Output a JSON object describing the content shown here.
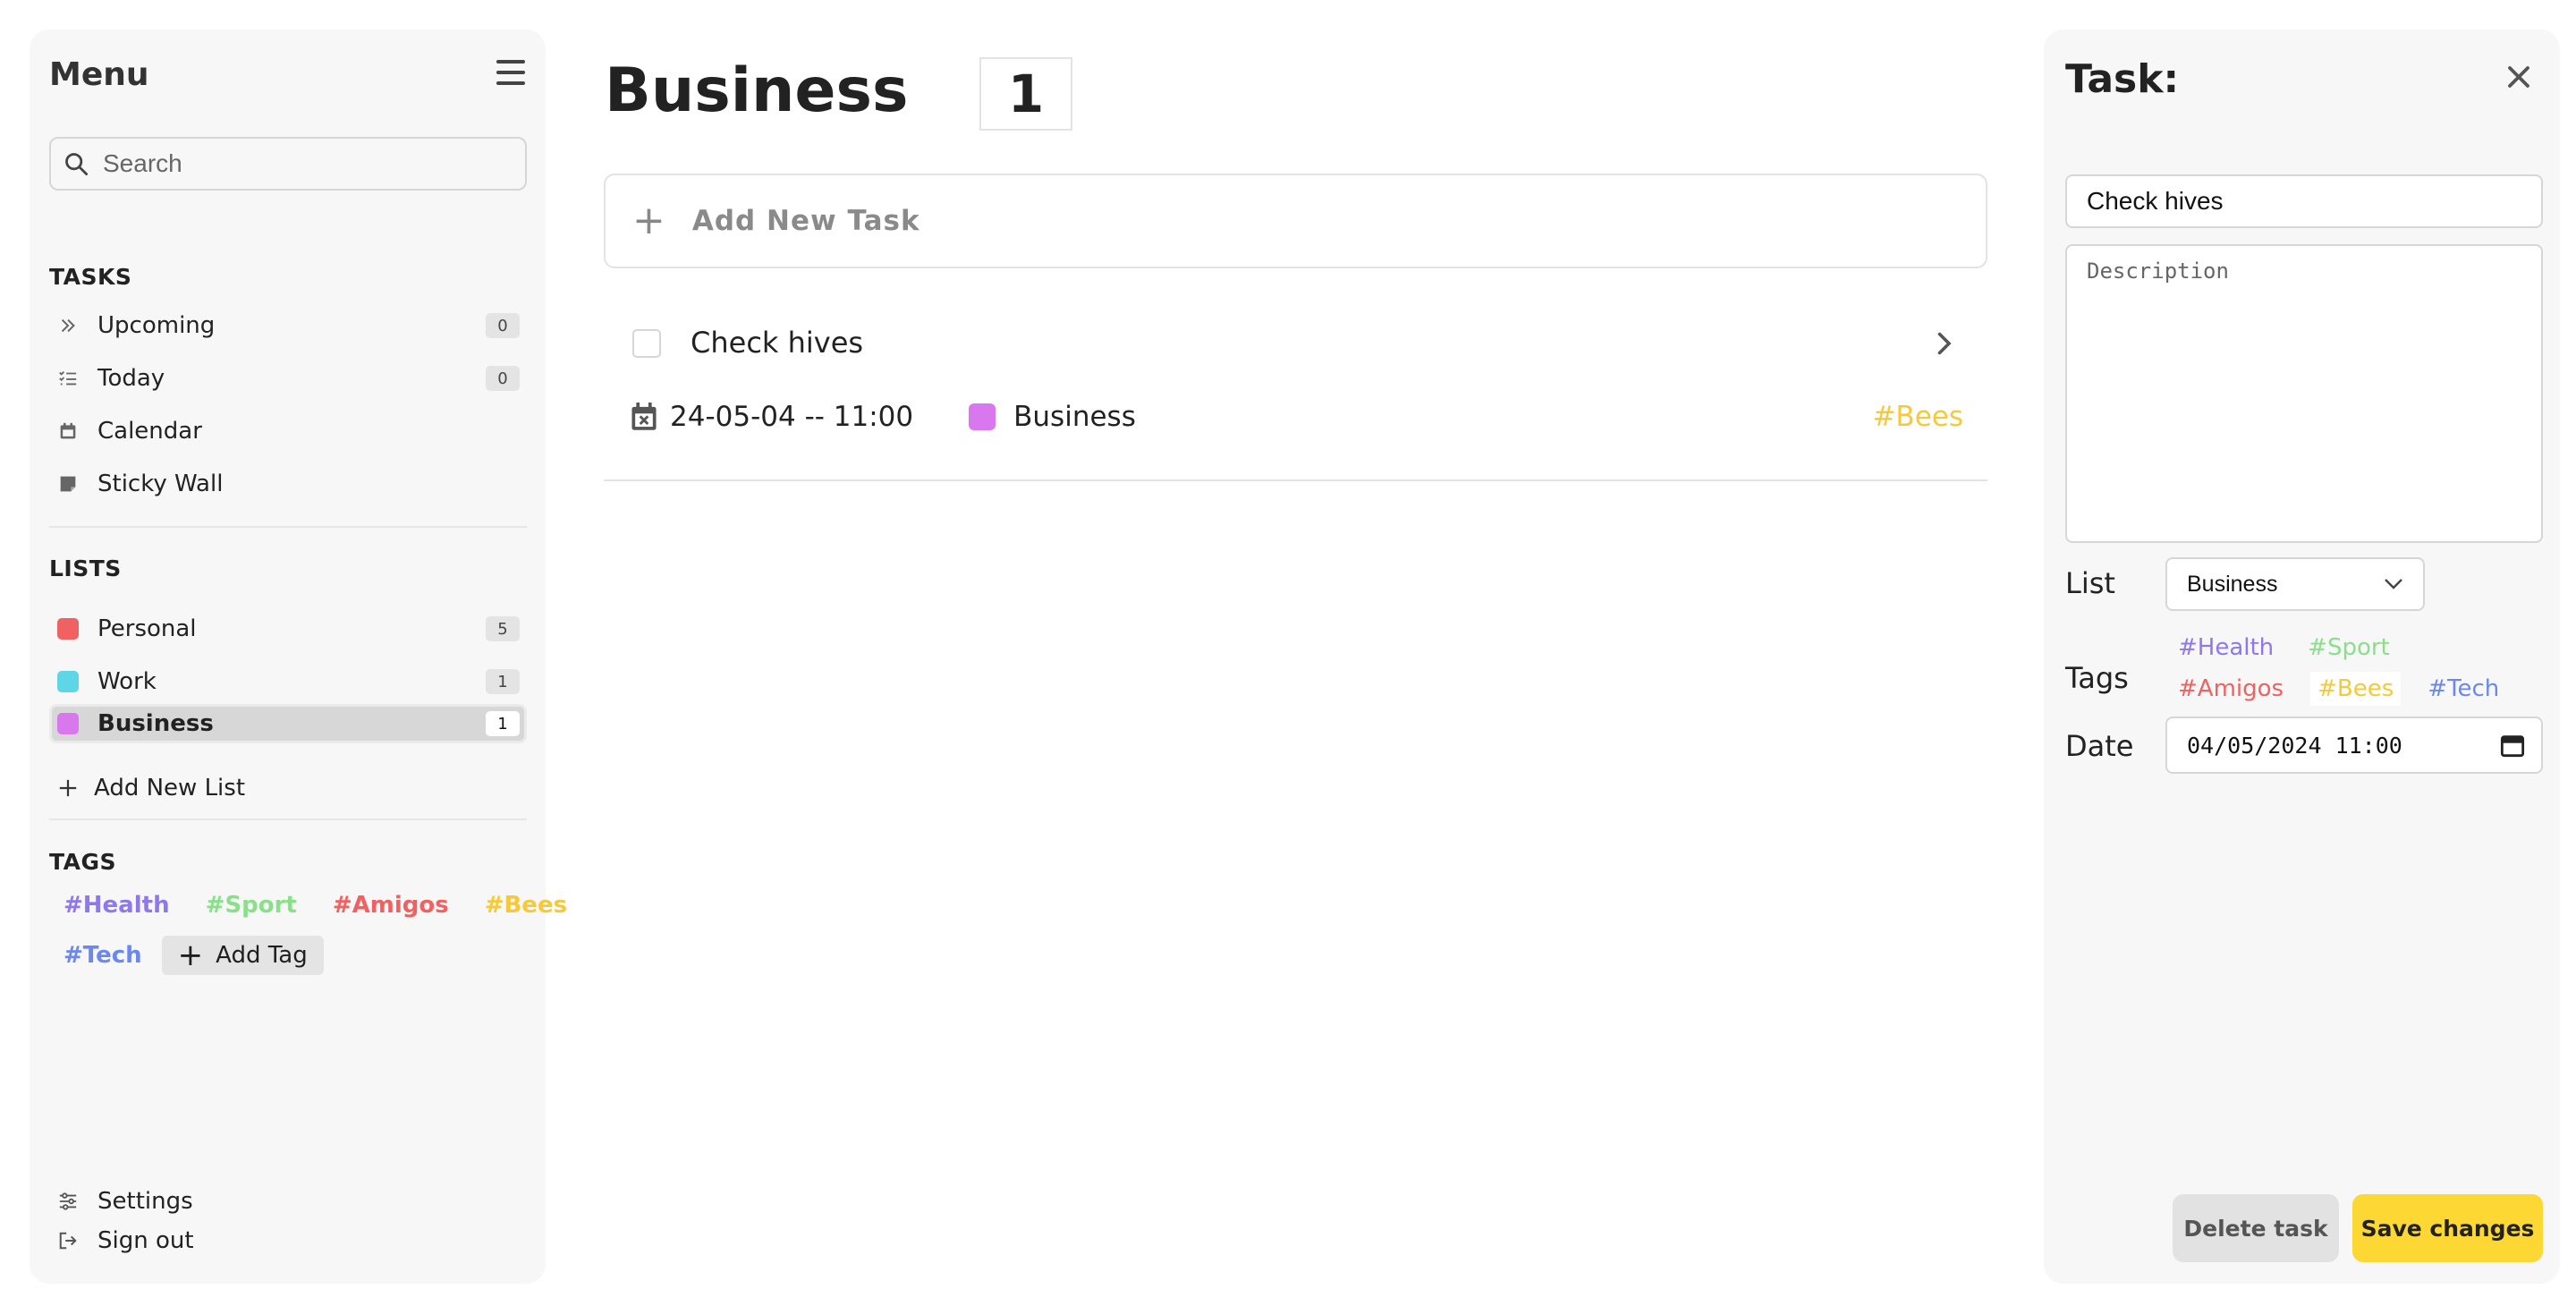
{
  "sidebar": {
    "title": "Menu",
    "search": {
      "placeholder": "Search",
      "value": ""
    },
    "tasks_label": "TASKS",
    "tasks": [
      {
        "label": "Upcoming",
        "count": "0",
        "icon": "double-chevron-right-icon"
      },
      {
        "label": "Today",
        "count": "0",
        "icon": "list-check-icon"
      },
      {
        "label": "Calendar",
        "count": "",
        "icon": "calendar-icon"
      },
      {
        "label": "Sticky Wall",
        "count": "",
        "icon": "sticky-note-icon"
      }
    ],
    "lists_label": "LISTS",
    "lists": [
      {
        "label": "Personal",
        "count": "5",
        "color": "#f06262"
      },
      {
        "label": "Work",
        "count": "1",
        "color": "#5ed6e8"
      },
      {
        "label": "Business",
        "count": "1",
        "color": "#d977ee",
        "active": true
      }
    ],
    "add_list_label": "Add New List",
    "tags_label": "TAGS",
    "tags": [
      {
        "label": "#Health",
        "color": "#8f78ee"
      },
      {
        "label": "#Sport",
        "color": "#8bdf8b"
      },
      {
        "label": "#Amigos",
        "color": "#f06262"
      },
      {
        "label": "#Bees",
        "color": "#f6c93a"
      },
      {
        "label": "#Tech",
        "color": "#6b88ee"
      }
    ],
    "add_tag_label": "Add Tag",
    "settings_label": "Settings",
    "signout_label": "Sign out"
  },
  "main": {
    "title": "Business",
    "count": "1",
    "add_task_label": "Add New Task",
    "task": {
      "name": "Check hives",
      "date": "24-05-04 -- 11:00",
      "list": "Business",
      "list_color": "#d977ee",
      "tag": "#Bees"
    }
  },
  "panel": {
    "title": "Task:",
    "name_value": "Check hives",
    "description_placeholder": "Description",
    "list_label": "List",
    "list_value": "Business",
    "tags_label": "Tags",
    "tags": [
      {
        "label": "#Health",
        "color": "#8f78ee"
      },
      {
        "label": "#Sport",
        "color": "#8bdf8b"
      },
      {
        "label": "#Amigos",
        "color": "#f06262"
      },
      {
        "label": "#Bees",
        "color": "#f6c93a"
      },
      {
        "label": "#Tech",
        "color": "#6b88ee"
      }
    ],
    "date_label": "Date",
    "date_value": "04/05/2024 11:00",
    "delete_label": "Delete task",
    "save_label": "Save changes"
  },
  "colors": {
    "accent": "#fdd835",
    "sidebar_bg": "#f7f7f7"
  }
}
